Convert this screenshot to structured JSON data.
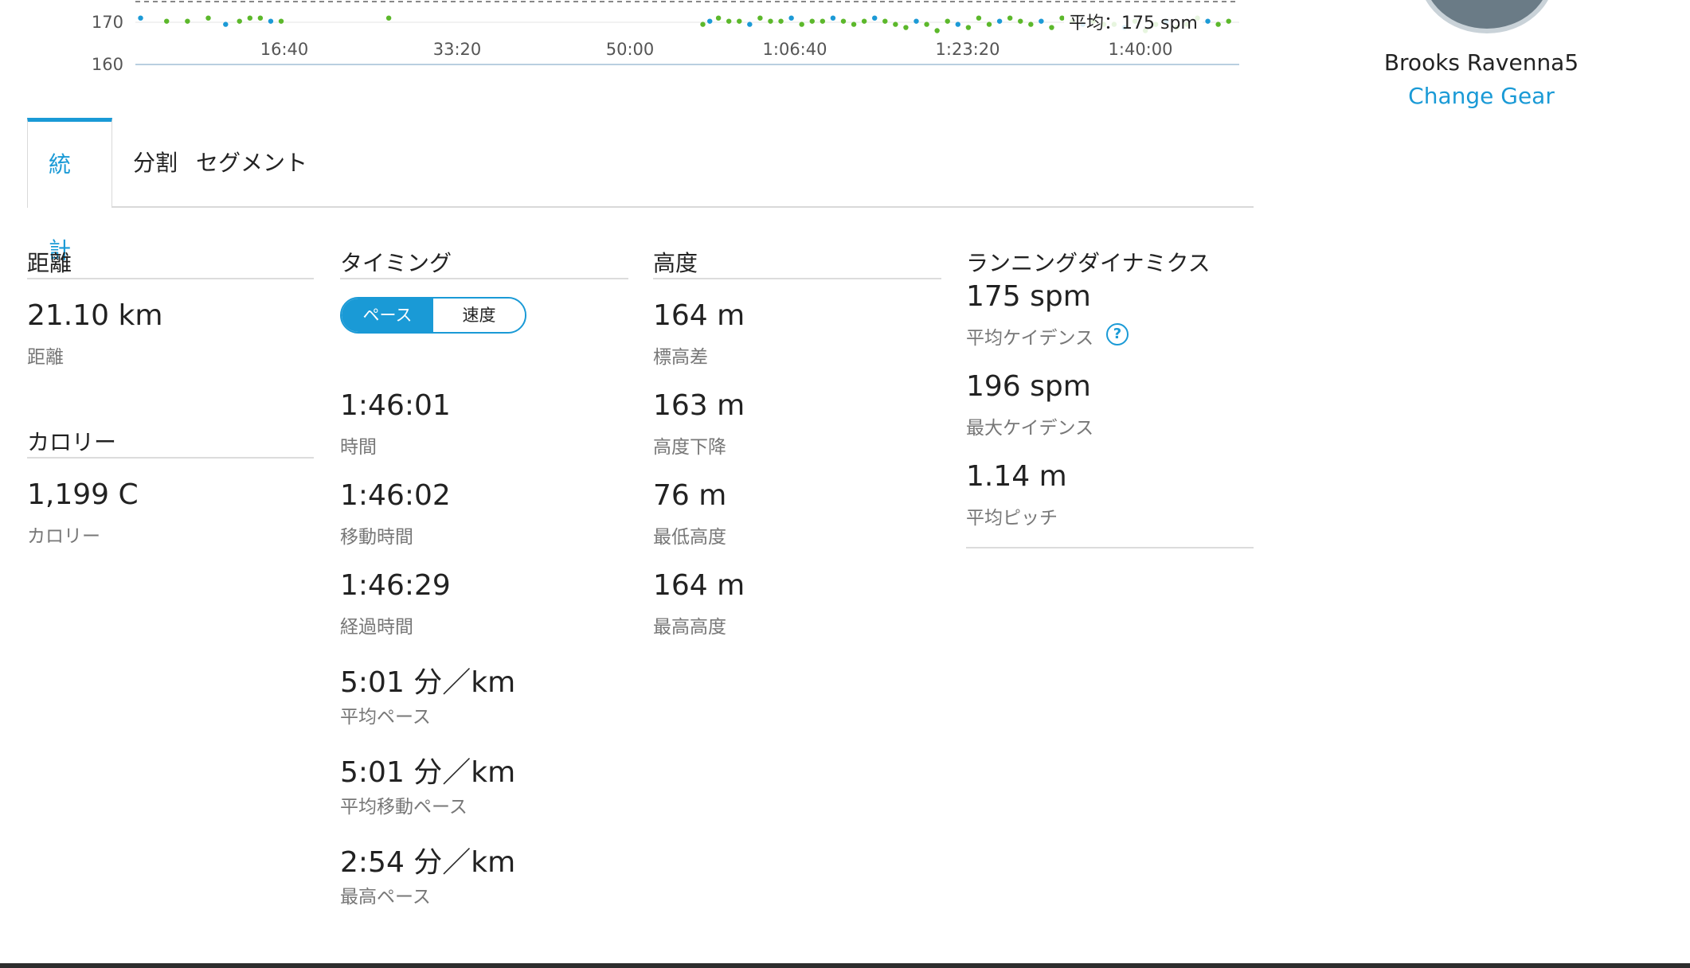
{
  "chart": {
    "y_ticks": [
      "170",
      "160"
    ],
    "x_ticks": [
      "16:40",
      "33:20",
      "50:00",
      "1:06:40",
      "1:23:20",
      "1:40:00"
    ],
    "avg_label": "平均：175 spm",
    "colors": {
      "green": "#5cb82b",
      "blue": "#1c9ad6",
      "axis": "#b9cfe0",
      "grid": "#e6e6e6"
    }
  },
  "chart_data": {
    "type": "scatter",
    "title": "",
    "xlabel": "",
    "ylabel": "",
    "x_ticks": [
      "16:40",
      "33:20",
      "50:00",
      "1:06:40",
      "1:23:20",
      "1:40:00"
    ],
    "y_ticks": [
      170,
      160
    ],
    "ylim": [
      160,
      180
    ],
    "xlim_seconds": [
      0,
      6361
    ],
    "average_line": {
      "value": 175,
      "label": "平均：175 spm"
    },
    "x": [
      30,
      180,
      300,
      420,
      520,
      600,
      660,
      720,
      780,
      840,
      1460,
      3270,
      3310,
      3360,
      3420,
      3480,
      3540,
      3600,
      3660,
      3720,
      3780,
      3840,
      3900,
      3960,
      4020,
      4080,
      4140,
      4200,
      4260,
      4320,
      4380,
      4440,
      4500,
      4560,
      4620,
      4680,
      4740,
      4800,
      4860,
      4920,
      4980,
      5040,
      5100,
      5160,
      5220,
      5280,
      5340,
      5400,
      5460,
      5520,
      5580,
      5640,
      5700,
      5760,
      5820,
      5880,
      5940,
      6000,
      6060,
      6120,
      6180,
      6240,
      6300
    ],
    "y": [
      174,
      173,
      173,
      174,
      172,
      173,
      174,
      174,
      173,
      173,
      174,
      172,
      173,
      174,
      173,
      173,
      172,
      174,
      173,
      173,
      174,
      172,
      173,
      173,
      174,
      173,
      172,
      173,
      174,
      173,
      172,
      171,
      173,
      172,
      170,
      173,
      172,
      171,
      174,
      172,
      173,
      174,
      173,
      172,
      173,
      171,
      174,
      173,
      172,
      173,
      172,
      172,
      171,
      173,
      170,
      172,
      173,
      171,
      172,
      174,
      173,
      172,
      173
    ]
  },
  "gear": {
    "name": "Brooks Ravenna5",
    "change_link": "Change Gear"
  },
  "tabs": [
    {
      "label": "統計"
    },
    {
      "label": "分割"
    },
    {
      "label": "セグメント"
    }
  ],
  "distance": {
    "title": "距離",
    "value": "21.10 km",
    "label": "距離"
  },
  "calories": {
    "title": "カロリー",
    "value": "1,199 C",
    "label": "カロリー"
  },
  "timing": {
    "title": "タイミング",
    "toggle_pace": "ペース",
    "toggle_speed": "速度",
    "stats": [
      {
        "value": "1:46:01",
        "label": "時間"
      },
      {
        "value": "1:46:02",
        "label": "移動時間"
      },
      {
        "value": "1:46:29",
        "label": "経過時間"
      },
      {
        "value": "5:01 分／km",
        "label": "平均ペース"
      },
      {
        "value": "5:01 分／km",
        "label": "平均移動ペース"
      },
      {
        "value": "2:54 分／km",
        "label": "最高ペース"
      }
    ]
  },
  "elevation": {
    "title": "高度",
    "stats": [
      {
        "value": "164 m",
        "label": "標高差"
      },
      {
        "value": "163 m",
        "label": "高度下降"
      },
      {
        "value": "76 m",
        "label": "最低高度"
      },
      {
        "value": "164 m",
        "label": "最高高度"
      }
    ]
  },
  "dynamics": {
    "title": "ランニングダイナミクス",
    "stats": [
      {
        "value": "175 spm",
        "label": "平均ケイデンス"
      },
      {
        "value": "196 spm",
        "label": "最大ケイデンス"
      },
      {
        "value": "1.14 m",
        "label": "平均ピッチ"
      }
    ],
    "help_icon": "question-circle-icon"
  }
}
